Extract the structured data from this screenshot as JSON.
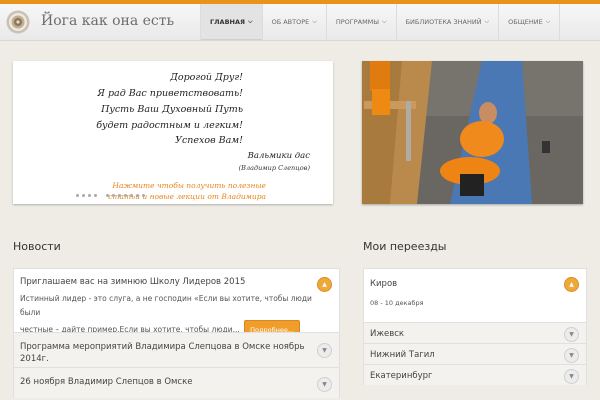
{
  "site": {
    "title": "Йога как она есть",
    "accent": "#e8941a"
  },
  "nav": [
    {
      "label": "ГЛАВНАЯ",
      "active": true
    },
    {
      "label": "ОБ АВТОРЕ"
    },
    {
      "label": "ПРОГРАММЫ"
    },
    {
      "label": "БИБЛИОТЕКА ЗНАНИЙ"
    },
    {
      "label": "ОБЩЕНИЕ"
    }
  ],
  "welcome": {
    "lines": [
      "Дорогой Друг!",
      "Я рад Вас приветствовать!",
      "Пусть Ваш Духовный Путь",
      "будет радостным и легким!",
      "Успехов Вам!"
    ],
    "signature": "Вальмики дас",
    "signature_sub": "(Владимир Слепцов)",
    "cta": [
      "Нажмите чтобы получить полезные",
      "статьи и новые лекции от Владимира"
    ]
  },
  "slider": {
    "slide_count": 12,
    "active_index": 4
  },
  "news": {
    "title": "Новости",
    "more_label": "Подробнее...",
    "items": [
      {
        "title": "Приглашаем вас на зимнюю Школу Лидеров 2015",
        "text": [
          "Истинный лидер - это слуга, а не господин «Если вы хотите, чтобы люди были",
          "честные – дайте пример.Если вы хотите, чтобы люди..."
        ]
      },
      {
        "title": "Программа мероприятий Владимира Слепцова в Омске ноябрь",
        "title2": "2014г."
      },
      {
        "title": "26 ноября Владимир Слепцов в Омске"
      }
    ]
  },
  "moves": {
    "title": "Мои переезды",
    "items": [
      {
        "city": "Киров",
        "dates": "08 - 10 декабря"
      },
      {
        "city": "Ижевск"
      },
      {
        "city": "Нижний Тагил"
      },
      {
        "city": "Екатеринбург"
      }
    ]
  }
}
